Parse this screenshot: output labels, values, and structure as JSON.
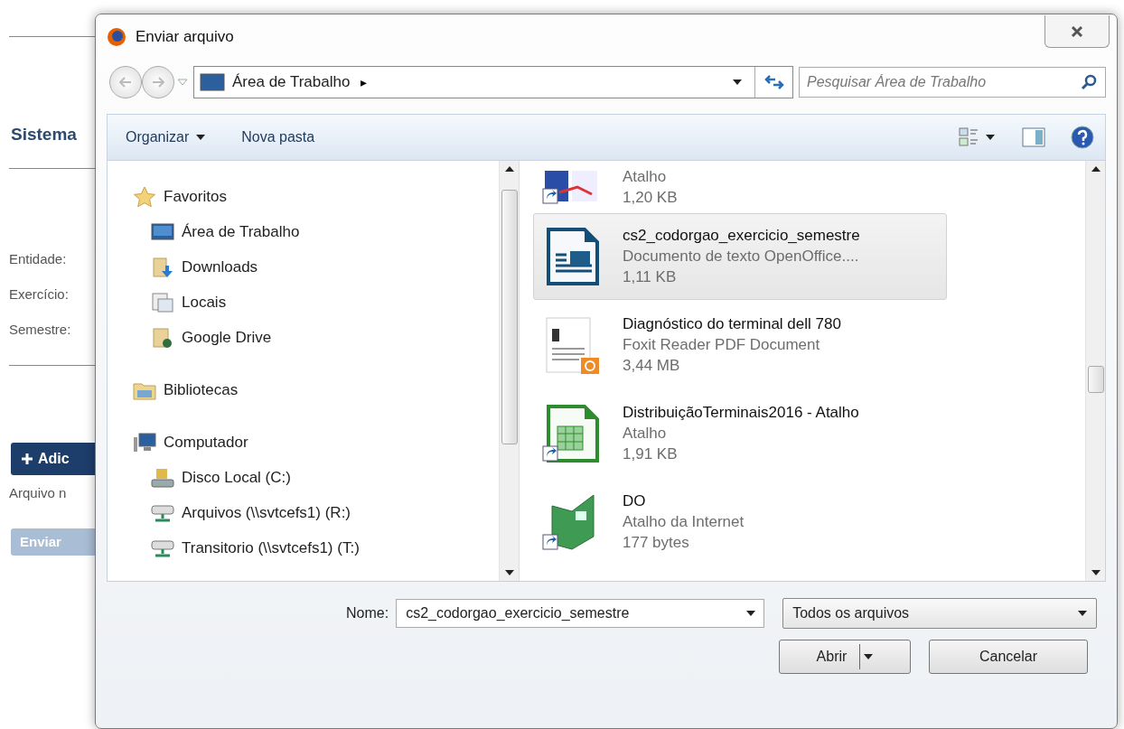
{
  "background": {
    "heading": "Sistema",
    "fields": [
      "Entidade:",
      "Exercício:",
      "Semestre:"
    ],
    "add_button": "Adic",
    "note": "Arquivo n",
    "send_button": "Enviar"
  },
  "dialog": {
    "title": "Enviar arquivo",
    "address": {
      "location": "Área de Trabalho",
      "separator": "▸",
      "search_placeholder": "Pesquisar Área de Trabalho"
    },
    "toolbar": {
      "organize": "Organizar",
      "new_folder": "Nova pasta"
    },
    "nav": [
      {
        "label": "Favoritos",
        "kind": "star",
        "children": [
          {
            "label": "Área de Trabalho",
            "kind": "desktop"
          },
          {
            "label": "Downloads",
            "kind": "download"
          },
          {
            "label": "Locais",
            "kind": "places"
          },
          {
            "label": "Google Drive",
            "kind": "drive"
          }
        ]
      },
      {
        "label": "Bibliotecas",
        "kind": "library"
      },
      {
        "label": "Computador",
        "kind": "computer",
        "children": [
          {
            "label": "Disco Local (C:)",
            "kind": "disk"
          },
          {
            "label": "Arquivos (\\\\svtcefs1) (R:)",
            "kind": "network"
          },
          {
            "label": "Transitorio (\\\\svtcefs1) (T:)",
            "kind": "network"
          }
        ]
      }
    ],
    "files": [
      {
        "kind": "pdf-shortcut",
        "type": "Atalho",
        "size": "1,20 KB",
        "selected": false
      },
      {
        "kind": "writer",
        "name": "cs2_codorgao_exercicio_semestre",
        "type": "Documento de texto OpenOffice....",
        "size": "1,11 KB",
        "selected": true
      },
      {
        "kind": "pdf",
        "name": "Diagnóstico do terminal dell 780",
        "type": "Foxit Reader PDF Document",
        "size": "3,44 MB",
        "selected": false
      },
      {
        "kind": "calc",
        "name": "DistribuiçãoTerminais2016 - Atalho",
        "type": "Atalho",
        "size": "1,91 KB",
        "selected": false
      },
      {
        "kind": "book",
        "name": "DO",
        "type": "Atalho da Internet",
        "size": "177 bytes",
        "selected": false
      }
    ],
    "name_label": "Nome:",
    "name_value": "cs2_codorgao_exercicio_semestre",
    "filter": "Todos os arquivos",
    "buttons": [
      {
        "label": "Abrir",
        "kind": "split"
      },
      {
        "label": "Cancelar",
        "kind": "plain"
      }
    ]
  }
}
